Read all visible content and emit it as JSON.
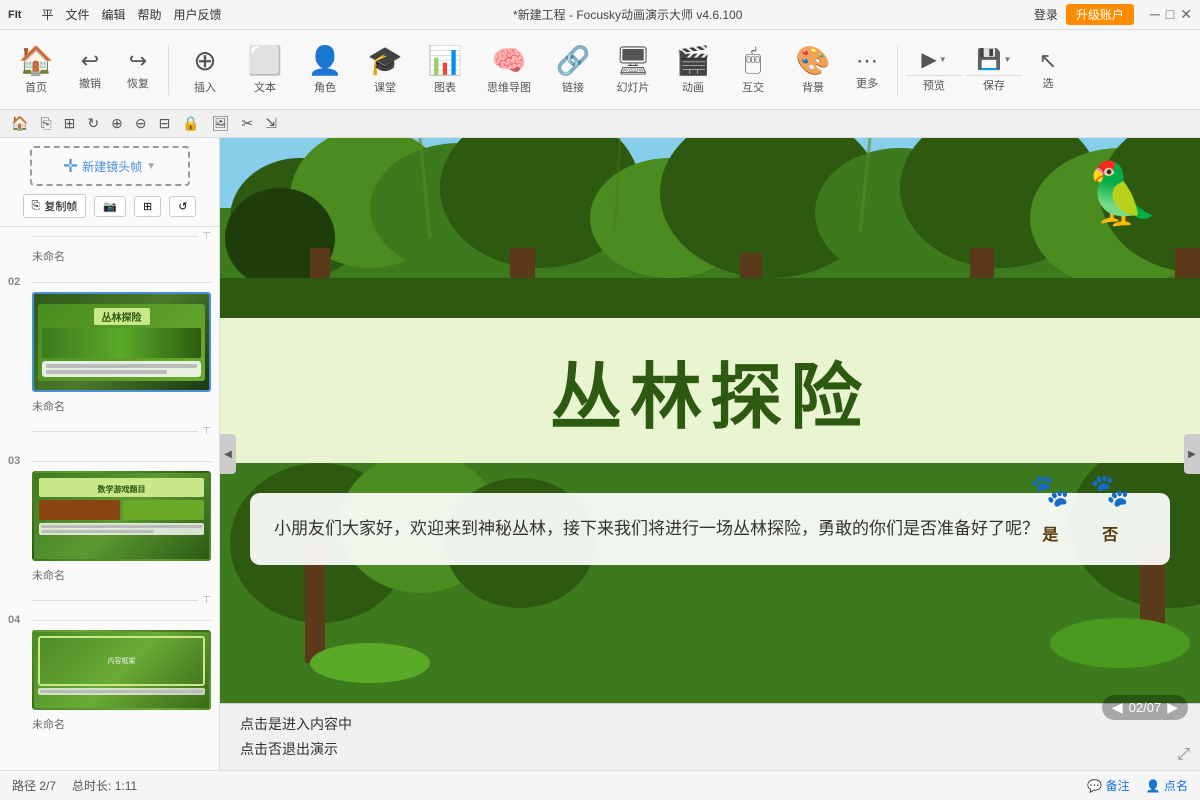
{
  "titlebar": {
    "logo": "FIt",
    "menus": [
      "平",
      "文件",
      "编辑",
      "帮助",
      "用户反馈"
    ],
    "title": "*新建工程 - Focusky动画演示大师 v4.6.100",
    "login": "登录",
    "upgrade": "升级账户",
    "win_min": "─",
    "win_max": "□",
    "win_close": "✕"
  },
  "toolbar": {
    "home": "首页",
    "undo": "撤销",
    "redo": "恢复",
    "insert": "插入",
    "text": "文本",
    "role": "角色",
    "classroom": "课堂",
    "chart": "图表",
    "mindmap": "思维导图",
    "link": "链接",
    "slide": "幻灯片",
    "animation": "动画",
    "interact": "互交",
    "background": "背景",
    "more": "更多",
    "preview": "预览",
    "save": "保存",
    "select": "选"
  },
  "sidebar": {
    "new_frame": "新建镜头帧",
    "copy_btn": "复制帧",
    "tools": [
      "📷",
      "⊞",
      "↺"
    ],
    "slides": [
      {
        "num": "",
        "label": "未命名",
        "type": "blank"
      },
      {
        "num": "02",
        "label": "未命名",
        "type": "jungle",
        "selected": true
      },
      {
        "num": "03",
        "label": "未命名",
        "type": "jungle2"
      },
      {
        "num": "04",
        "label": "未命名",
        "type": "jungle3"
      }
    ]
  },
  "canvas": {
    "main_title": "丛林探险",
    "dialog": {
      "text": "小朋友们大家好，欢迎来到神秘丛林，接下来我们将进行一场丛林探险，勇敢的你们是否准备好了呢？",
      "yes": "是",
      "no": "否"
    },
    "hint_line1": "点击是进入内容中",
    "hint_line2": "点击否退出演示",
    "nav": "02/07"
  },
  "statusbar": {
    "path": "路径 2/7",
    "duration": "总时长: 1:11",
    "comment": "备注",
    "pointname": "点名"
  }
}
